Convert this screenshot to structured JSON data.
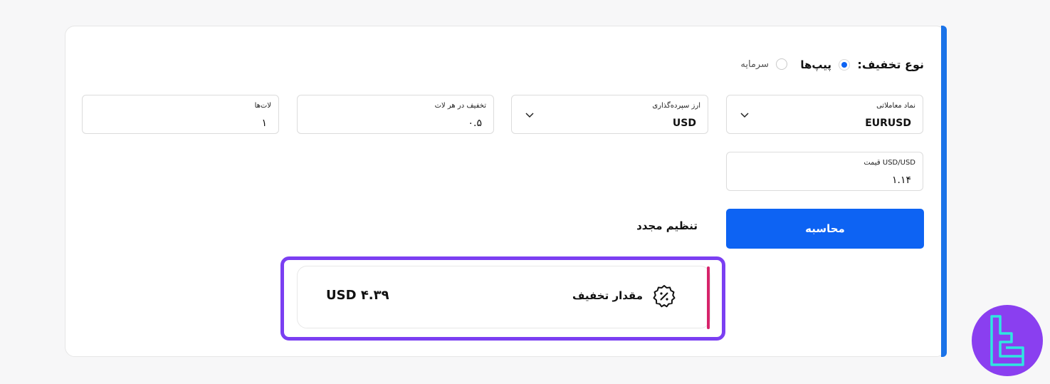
{
  "colors": {
    "primary": "#0d63f3",
    "accent_bar": "#1a73e8",
    "highlight": "#7b3ff2",
    "result_edge": "#d7246b",
    "logo_bg": "#8a3ff0",
    "logo_fg": "#2ee6e0"
  },
  "discount_type": {
    "label": "نوع تخفیف:",
    "options": [
      {
        "label": "پیپ‌ها",
        "selected": true
      },
      {
        "label": "سرمایه",
        "selected": false
      }
    ]
  },
  "fields": {
    "symbol": {
      "label": "نماد معاملاتی",
      "value": "EURUSD"
    },
    "deposit_currency": {
      "label": "ارز سپرده‌گذاری",
      "value": "USD"
    },
    "discount_per_lot": {
      "label": "تخفیف در هر لات",
      "value": "۰.۵"
    },
    "lots": {
      "label": "لات‌ها",
      "value": "۱"
    },
    "price": {
      "label": "USD/USD قیمت",
      "value": "۱.۱۴"
    }
  },
  "buttons": {
    "calculate": "محاسبه",
    "reset": "تنظیم مجدد"
  },
  "result": {
    "label": "مقدار تخفیف",
    "amount": "۴.۳۹ USD",
    "icon": "discount-badge-icon"
  },
  "logo": {
    "icon": "tradingfinder-logo-icon"
  }
}
